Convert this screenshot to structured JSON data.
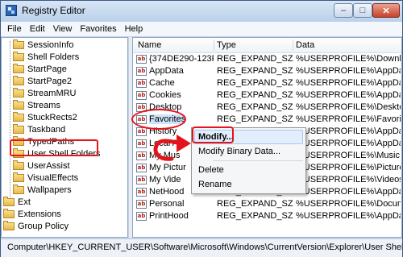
{
  "window": {
    "title": "Registry Editor"
  },
  "controls": {
    "minimize": "–",
    "maximize": "□",
    "close": "✕"
  },
  "menu": [
    "File",
    "Edit",
    "View",
    "Favorites",
    "Help"
  ],
  "tree": {
    "items": [
      "SessionInfo",
      "Shell Folders",
      "StartPage",
      "StartPage2",
      "StreamMRU",
      "Streams",
      "StuckRects2",
      "Taskband",
      "TypedPaths",
      "User Shell Folders",
      "UserAssist",
      "VisualEffects",
      "Wallpapers",
      "Ext",
      "Extensions",
      "Group Policy"
    ],
    "selected": "User Shell Folders"
  },
  "list": {
    "columns": [
      "Name",
      "Type",
      "Data"
    ],
    "rows": [
      {
        "name": "{374DE290-123F...",
        "type": "REG_EXPAND_SZ",
        "data": "%USERPROFILE%\\Downlo"
      },
      {
        "name": "AppData",
        "type": "REG_EXPAND_SZ",
        "data": "%USERPROFILE%\\AppDat"
      },
      {
        "name": "Cache",
        "type": "REG_EXPAND_SZ",
        "data": "%USERPROFILE%\\AppDat"
      },
      {
        "name": "Cookies",
        "type": "REG_EXPAND_SZ",
        "data": "%USERPROFILE%\\AppDat"
      },
      {
        "name": "Desktop",
        "type": "REG_EXPAND_SZ",
        "data": "%USERPROFILE%\\Desktop"
      },
      {
        "name": "Favorites",
        "type": "REG_EXPAND_SZ",
        "data": "%USERPROFILE%\\Favorite"
      },
      {
        "name": "History",
        "type": "REG_EXPAND_SZ",
        "data": "%USERPROFILE%\\AppDat"
      },
      {
        "name": "Local Ap",
        "type": "REG_EXPAND_SZ",
        "data": "%USERPROFILE%\\AppDat"
      },
      {
        "name": "My Mus",
        "type": "REG_EXPAND_SZ",
        "data": "%USERPROFILE%\\Music"
      },
      {
        "name": "My Pictur",
        "type": "REG_EXPAND_SZ",
        "data": "%USERPROFILE%\\Pictures"
      },
      {
        "name": "My Vide",
        "type": "REG_EXPAND_SZ",
        "data": "%USERPROFILE%\\Videos"
      },
      {
        "name": "NetHood",
        "type": "REG_EXPAND_SZ",
        "data": "%USERPROFILE%\\AppDat"
      },
      {
        "name": "Personal",
        "type": "REG_EXPAND_SZ",
        "data": "%USERPROFILE%\\Docum"
      },
      {
        "name": "PrintHood",
        "type": "REG_EXPAND_SZ",
        "data": "%USERPROFILE%\\AppDat"
      }
    ],
    "selected": "Favorites",
    "value_icon": "ab"
  },
  "context_menu": {
    "items": [
      "Modify...",
      "Modify Binary Data...",
      "Delete",
      "Rename"
    ],
    "hovered": "Modify..."
  },
  "status": {
    "path": "Computer\\HKEY_CURRENT_USER\\Software\\Microsoft\\Windows\\CurrentVersion\\Explorer\\User Shell Folders"
  },
  "annotation": {
    "color": "#e3141c"
  }
}
